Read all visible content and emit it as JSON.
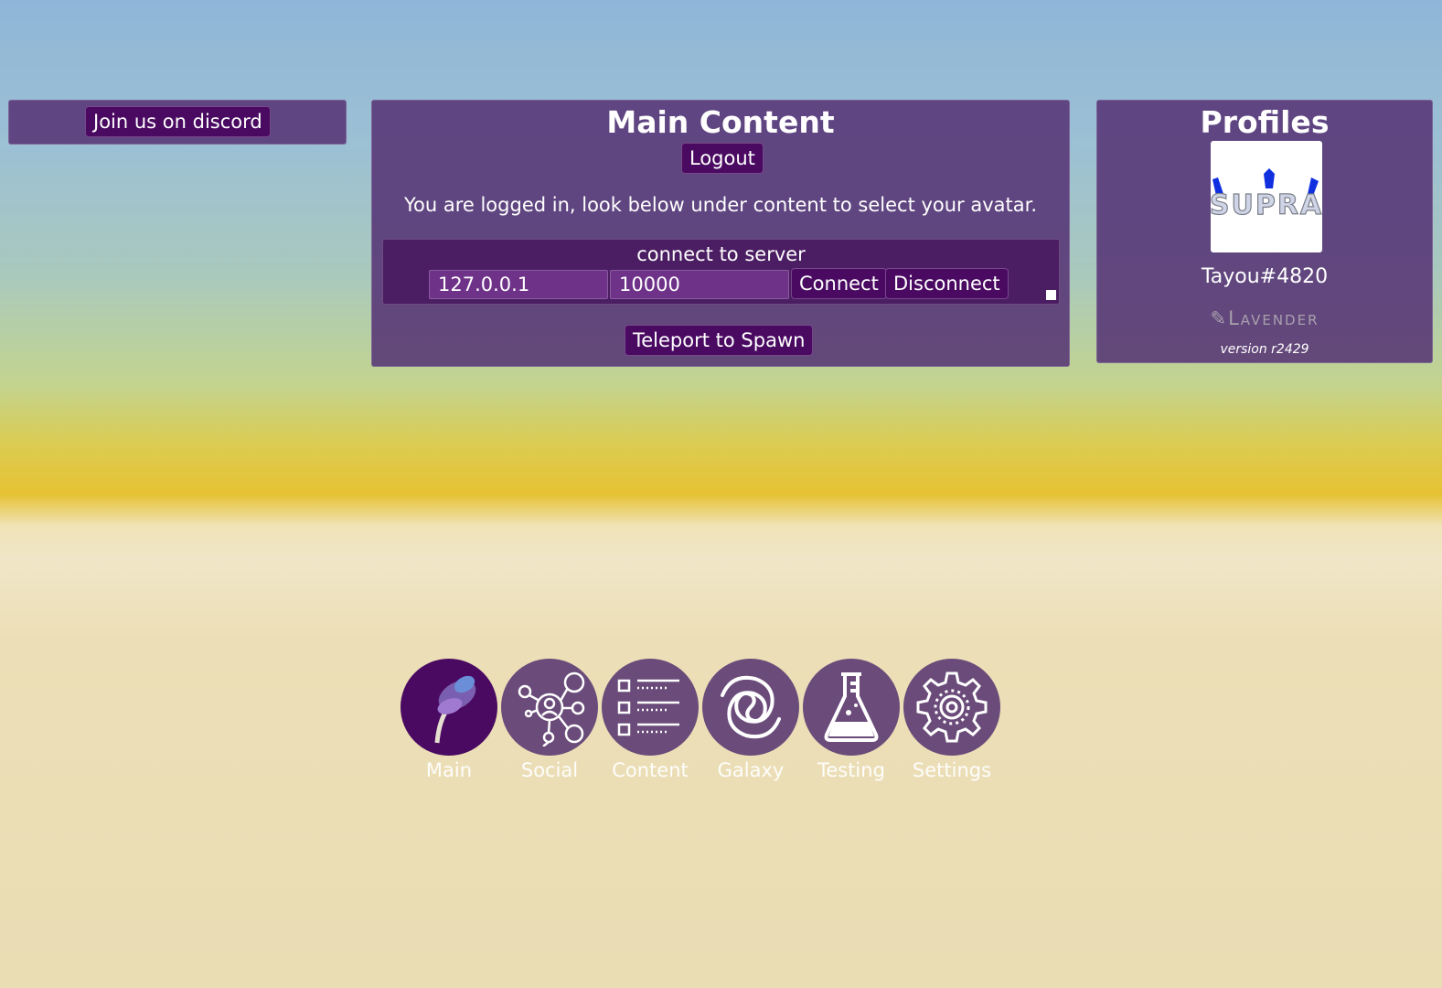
{
  "discord": {
    "button_label": "Join us on discord"
  },
  "main": {
    "title": "Main Content",
    "logout_label": "Logout",
    "login_message": "You are logged in, look below under content to select your avatar.",
    "server": {
      "label": "connect to server",
      "ip_value": "127.0.0.1",
      "port_value": "10000",
      "connect_label": "Connect",
      "disconnect_label": "Disconnect"
    },
    "teleport_label": "Teleport to Spawn"
  },
  "profiles": {
    "title": "Profiles",
    "avatar_text": "SUPRA",
    "username": "Tayou#4820",
    "brand": "Lavender",
    "version": "version r2429"
  },
  "dock": {
    "items": [
      {
        "label": "Main",
        "icon": "lavender-icon",
        "active": true
      },
      {
        "label": "Social",
        "icon": "network-icon",
        "active": false
      },
      {
        "label": "Content",
        "icon": "checklist-icon",
        "active": false
      },
      {
        "label": "Galaxy",
        "icon": "spiral-icon",
        "active": false
      },
      {
        "label": "Testing",
        "icon": "flask-icon",
        "active": false
      },
      {
        "label": "Settings",
        "icon": "gear-icon",
        "active": false
      }
    ]
  },
  "colors": {
    "panel": "#563475",
    "button": "#4a0a62",
    "input": "#6e3288",
    "dock_circle": "#6a4b7a",
    "dock_active": "#4a0a62"
  }
}
